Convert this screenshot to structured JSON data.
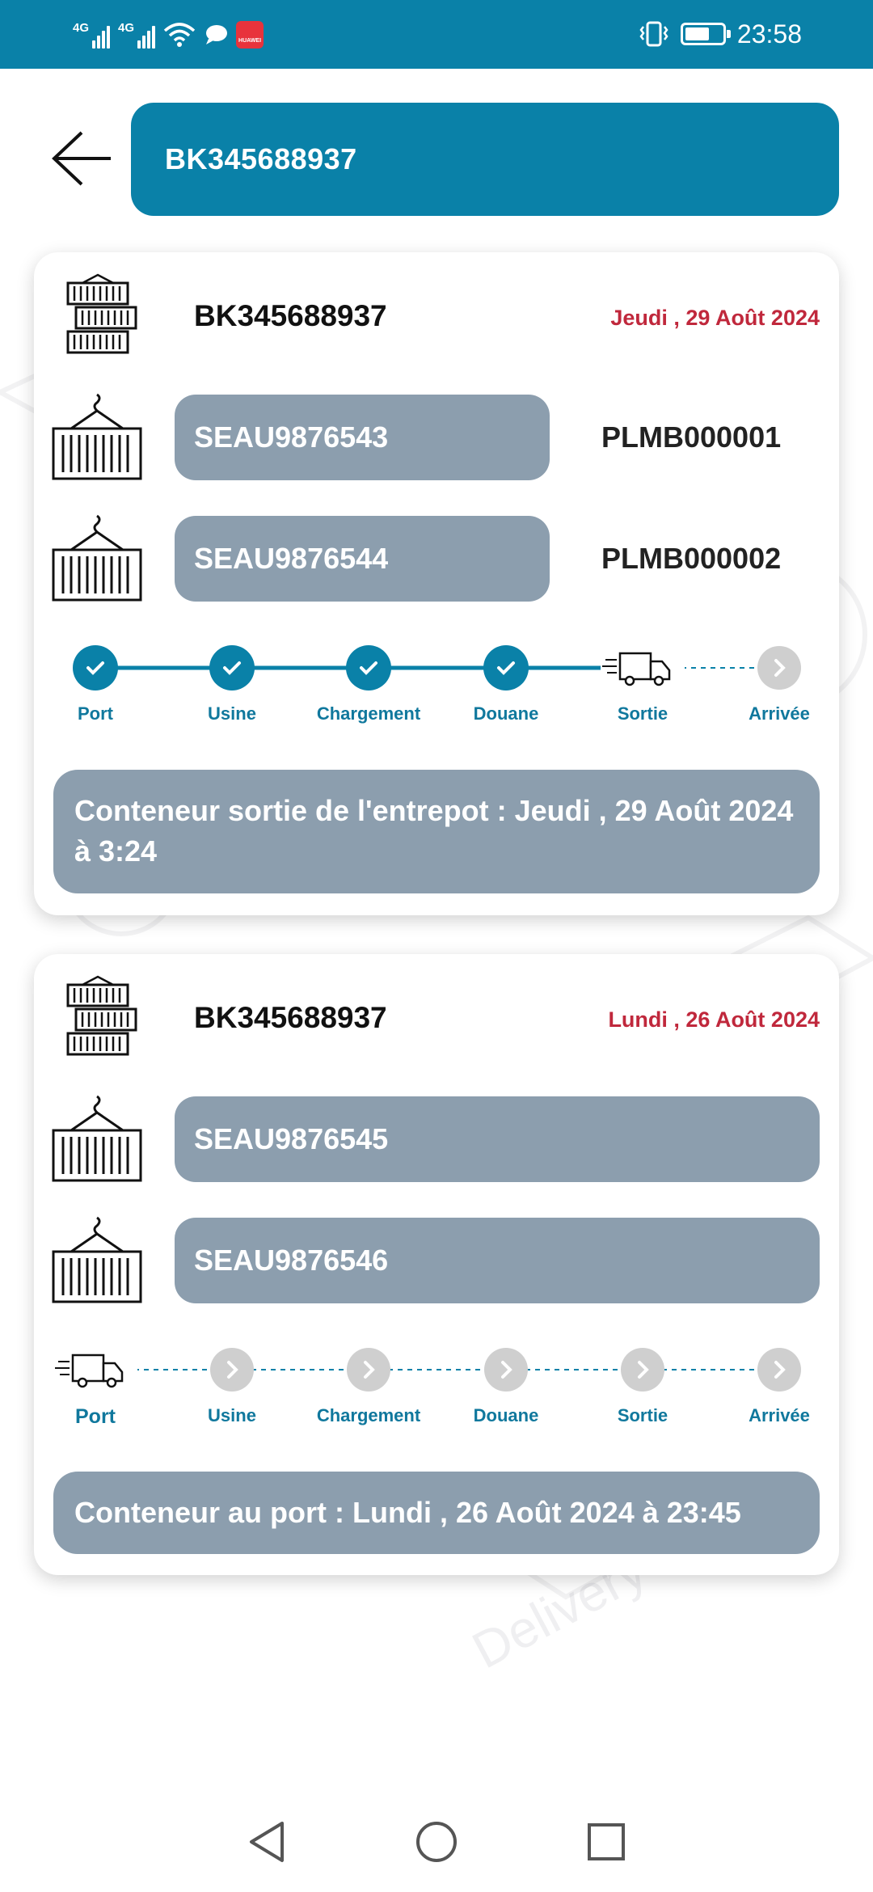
{
  "status_bar": {
    "sim1": "4G",
    "sim2": "4G",
    "huawei_badge": "HUAWEI",
    "time": "23:58",
    "battery_level": 0.65
  },
  "header": {
    "search_value": "BK345688937"
  },
  "colors": {
    "accent": "#0a81a8",
    "pill_grey": "#8c9eae",
    "date_red": "#c0283c",
    "step_label": "#10789d",
    "pending": "#cfcfcf"
  },
  "shipments": [
    {
      "booking": "BK345688937",
      "date": "Jeudi , 29 Août 2024",
      "containers": [
        {
          "number": "SEAU9876543",
          "seal": "PLMB000001"
        },
        {
          "number": "SEAU9876544",
          "seal": "PLMB000002"
        }
      ],
      "steps": [
        "Port",
        "Usine",
        "Chargement",
        "Douane",
        "Sortie",
        "Arrivée"
      ],
      "current_step": 4,
      "status": "Conteneur sortie de l'entrepot  : Jeudi , 29 Août 2024 à 3:24"
    },
    {
      "booking": "BK345688937",
      "date": "Lundi , 26 Août 2024",
      "containers": [
        {
          "number": "SEAU9876545",
          "seal": ""
        },
        {
          "number": "SEAU9876546",
          "seal": ""
        }
      ],
      "steps": [
        "Port",
        "Usine",
        "Chargement",
        "Douane",
        "Sortie",
        "Arrivée"
      ],
      "current_step": 0,
      "status": "Conteneur au port  : Lundi , 26 Août 2024 à 23:45"
    }
  ],
  "nav": {
    "back": "back-icon",
    "home": "home-icon",
    "recents": "recents-icon"
  }
}
